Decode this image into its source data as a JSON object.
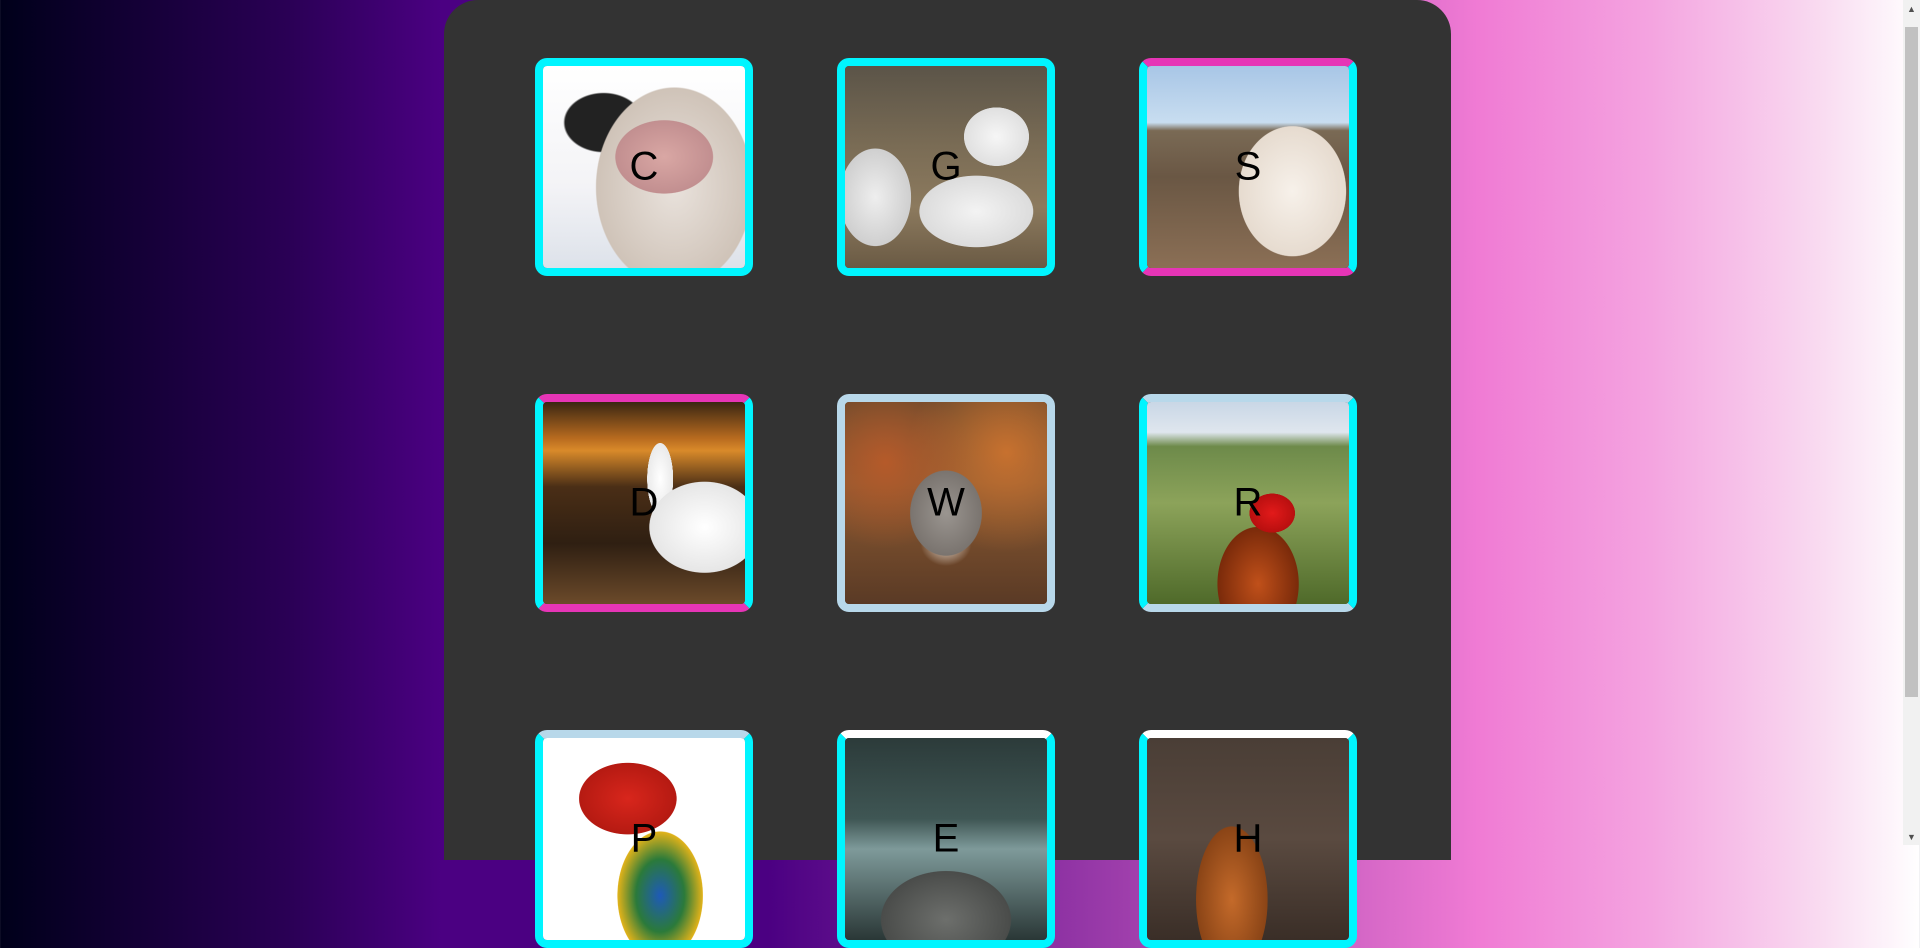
{
  "cards": [
    {
      "letter": "C",
      "animal": "cow"
    },
    {
      "letter": "G",
      "animal": "goat"
    },
    {
      "letter": "S",
      "animal": "sheep"
    },
    {
      "letter": "D",
      "animal": "duck"
    },
    {
      "letter": "W",
      "animal": "wolf"
    },
    {
      "letter": "R",
      "animal": "rooster"
    },
    {
      "letter": "P",
      "animal": "parrot"
    },
    {
      "letter": "E",
      "animal": "elephant"
    },
    {
      "letter": "H",
      "animal": "horse"
    }
  ],
  "colors": {
    "border_cyan": "#00f5ff",
    "border_pink": "#e635b6",
    "border_light": "#b8d8ea",
    "panel": "#333333"
  },
  "scrollbar": {
    "up_icon": "triangle-up-icon",
    "down_icon": "triangle-down-icon"
  }
}
